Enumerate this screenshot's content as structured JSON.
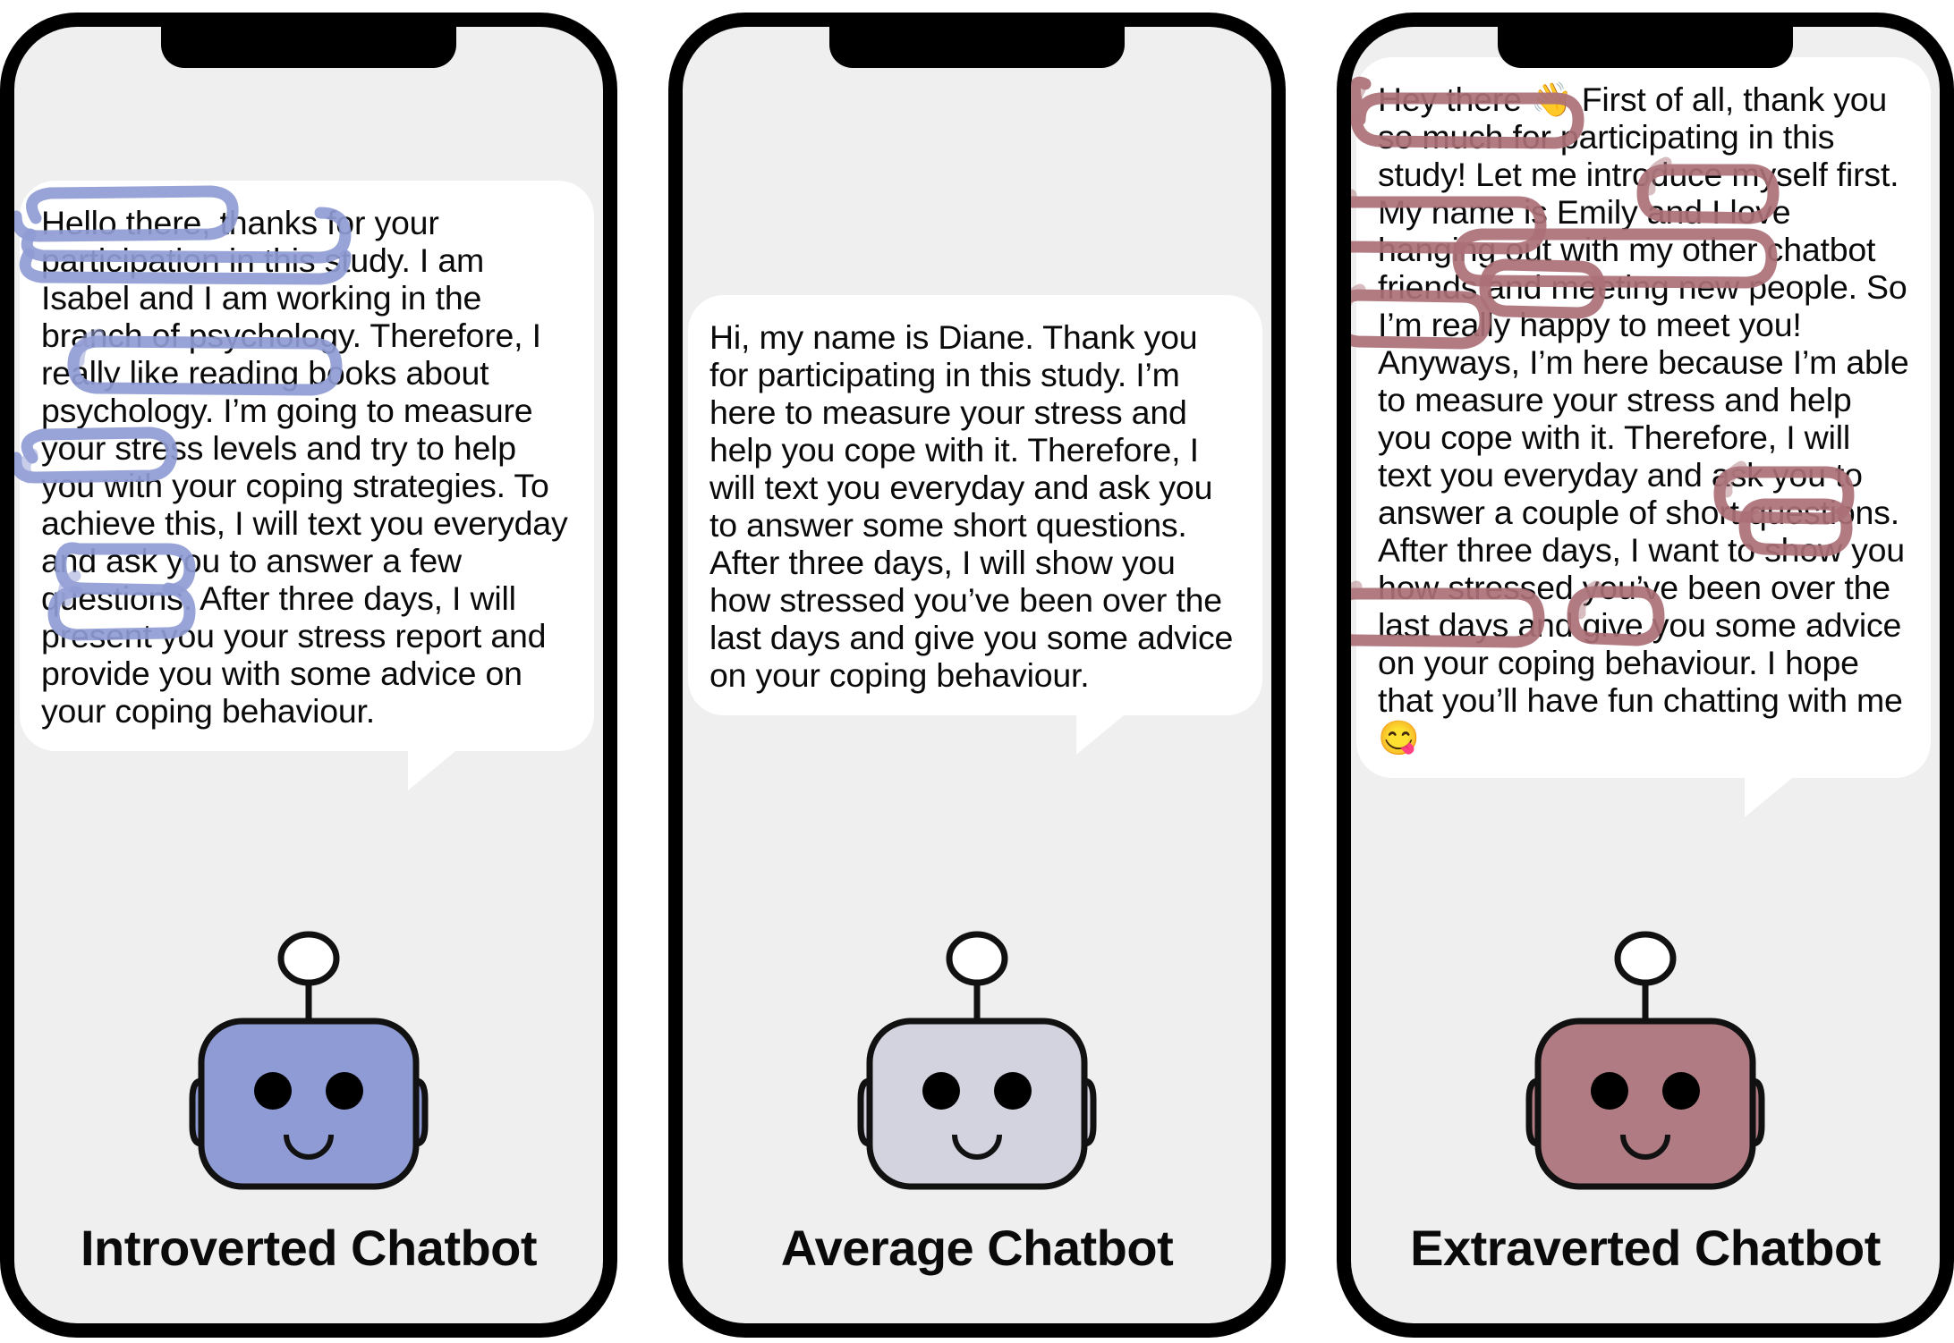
{
  "phones": [
    {
      "id": "introverted",
      "caption": "Introverted Chatbot",
      "message": "Hello there, thanks for your participation in this study. I am Isabel and I am working in the branch of psychology. Therefore, I really like reading books about psychology. I’m going to measure your stress levels and try to help you with your coping strategies. To achieve this, I will text you everyday and ask you to answer a few questions. After three days, I will present you your stress report and provide you with some advice on your coping behaviour.",
      "robot_color": "#8f9bd4",
      "annotation_color": "#8f9bd4",
      "highlighted_phrases": [
        "Hello there",
        "participation",
        "really like reading books about",
        "achieve this",
        "present",
        "provide"
      ],
      "bot_name": "Isabel"
    },
    {
      "id": "average",
      "caption": "Average Chatbot",
      "message": "Hi, my name is Diane. Thank you for participating in this study. I’m here to measure your stress and help you cope with it. Therefore, I will text you everyday and ask you to answer some short questions. After three days, I will show you how stressed you’ve been over the last days and give you some advice on your coping behaviour.",
      "robot_color": "#d2d3df",
      "annotation_color": "",
      "highlighted_phrases": [],
      "bot_name": "Diane"
    },
    {
      "id": "extraverted",
      "caption": "Extraverted Chatbot",
      "message": "Hey there 👋 First of all, thank you so much for participating in this study! Let me introduce myself first. My name is Emily and I love hanging out with my other chatbot friends and meeting new people. So I’m really happy to meet you! Anyways, I’m here because I’m able to measure your stress and help you cope with it. Therefore, I will text you everyday and ask you to answer a couple of short questions. After three days, I want to show you how stressed you’ve been over the last days and give you some advice on your coping behaviour. I hope that you’ll have fun chatting with me 😋",
      "robot_color": "#b07b82",
      "annotation_color": "#ab7077",
      "highlighted_phrases": [
        "Hey there 👋",
        "I love",
        "hanging out",
        "meeting new people.",
        "happy",
        "Anyways,",
        "you’ve",
        "give",
        "fun chatting",
        "😋"
      ],
      "bot_name": "Emily"
    }
  ],
  "icons": {
    "wave_hand": "👋",
    "smiling_face_tongue": "😋"
  },
  "colors": {
    "phone_frame": "#000000",
    "screen_background": "#efefef",
    "bubble_background": "#ffffff",
    "text": "#0a0a0a",
    "introverted_accent": "#8f9bd4",
    "average_accent": "#d2d3df",
    "extraverted_accent": "#b07b82"
  }
}
